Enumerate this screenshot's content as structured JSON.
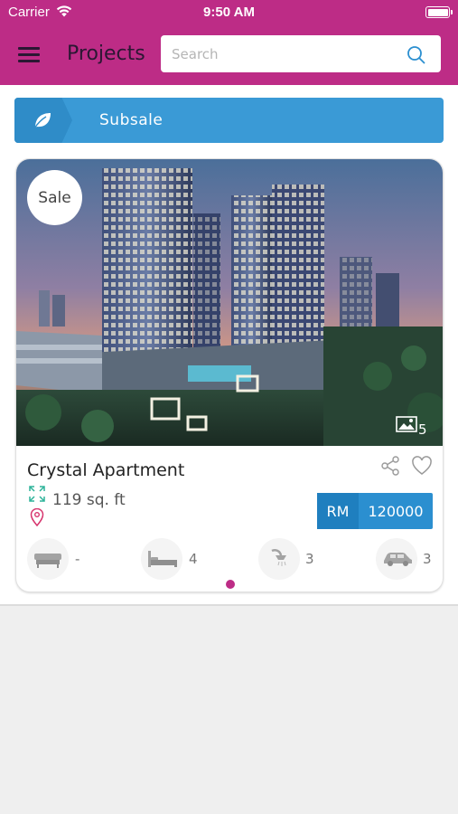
{
  "status_bar": {
    "carrier": "Carrier",
    "time": "9:50 AM"
  },
  "nav": {
    "title": "Projects",
    "search_placeholder": "Search"
  },
  "banner": {
    "label": "Subsale",
    "icon": "leaf-icon"
  },
  "listing": {
    "badge": "Sale",
    "photo_count": "5",
    "title": "Crystal Apartment",
    "size": "119 sq. ft",
    "price_currency": "RM",
    "price_amount": "120000",
    "amenities": [
      {
        "icon": "sofa-icon",
        "value": "-"
      },
      {
        "icon": "bed-icon",
        "value": "4"
      },
      {
        "icon": "shower-icon",
        "value": "3"
      },
      {
        "icon": "car-icon",
        "value": "3"
      }
    ]
  },
  "colors": {
    "header": "#bd2c86",
    "banner": "#3a9ad6",
    "price": "#2b8fd0",
    "page_dot": "#bd2c86"
  }
}
